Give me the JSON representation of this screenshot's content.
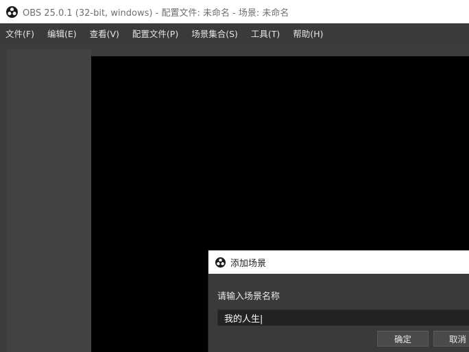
{
  "window": {
    "title": "OBS 25.0.1 (32-bit, windows) - 配置文件: 未命名 - 场景: 未命名",
    "logo_icon": "obs-logo-icon"
  },
  "menubar": {
    "items": [
      {
        "label": "文件(F)"
      },
      {
        "label": "编辑(E)"
      },
      {
        "label": "查看(V)"
      },
      {
        "label": "配置文件(P)"
      },
      {
        "label": "场景集合(S)"
      },
      {
        "label": "工具(T)"
      },
      {
        "label": "帮助(H)"
      }
    ]
  },
  "dialog": {
    "title": "添加场景",
    "prompt": "请输入场景名称",
    "input_value": "我的人生|",
    "ok_label": "确定",
    "cancel_label": "取消"
  },
  "colors": {
    "titlebar_bg": "#ffffff",
    "menubar_bg": "#3a3a3a",
    "workspace_bg": "#3c3c3c",
    "preview_bg": "#000000",
    "dialog_bg": "#3a3a3a",
    "input_bg": "#232323"
  }
}
